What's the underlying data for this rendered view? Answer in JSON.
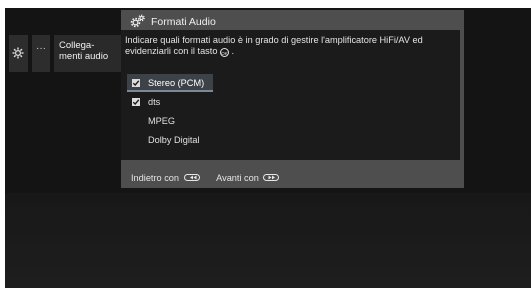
{
  "menu": {
    "more_label": "···",
    "connections_label": "Collega-\nmenti audio"
  },
  "dialog": {
    "title": "Formati Audio",
    "description_before_icon": "Indicare quali formati audio è in grado di gestire l'amplificatore HiFi/AV ed evidenziarli con il tasto",
    "ok_icon_text": "OK",
    "description_after_icon": " ."
  },
  "options": [
    {
      "label": "Stereo (PCM)",
      "checked": true,
      "focused": true
    },
    {
      "label": "dts",
      "checked": true,
      "focused": false
    },
    {
      "label": "MPEG",
      "checked": false,
      "focused": false
    },
    {
      "label": "Dolby Digital",
      "checked": false,
      "focused": false
    }
  ],
  "footer": {
    "back_label": "Indietro con",
    "back_icon": "rewind-button-icon",
    "forward_label": "Avanti con",
    "forward_icon": "fast-forward-button-icon"
  },
  "colors": {
    "screen_bg": "#141414",
    "dialog_frame": "#4e4e4e",
    "dialog_body": "#1b1b1b",
    "focus_highlight": "#3d4249"
  }
}
